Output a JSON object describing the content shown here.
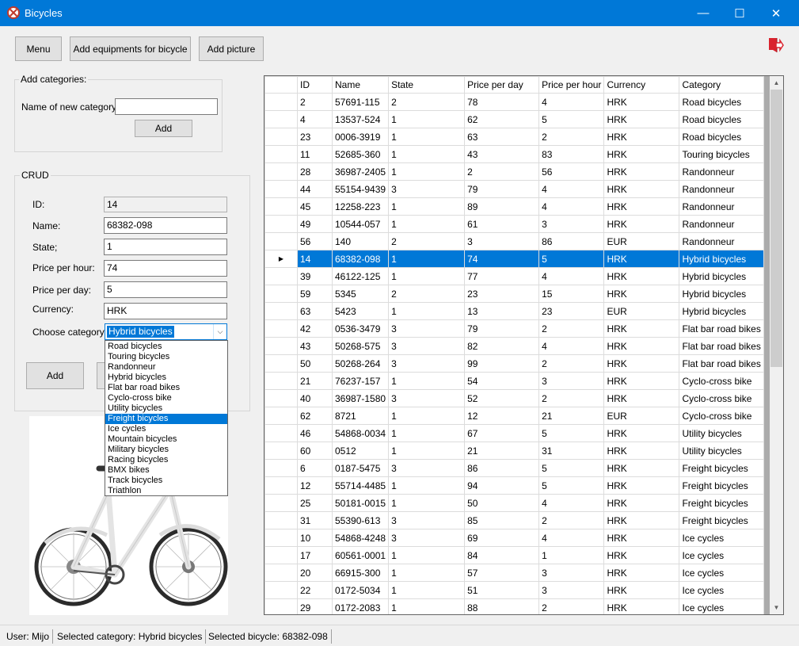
{
  "window": {
    "title": "Bicycles",
    "minimize": "—",
    "maximize": "☐",
    "close": "✕"
  },
  "toolbar": {
    "menu": "Menu",
    "add_equipment": "Add equipments for bicycle",
    "add_picture": "Add picture"
  },
  "categories_group": {
    "title": "Add categories:",
    "name_label": "Name of new category:",
    "name_value": "",
    "add": "Add"
  },
  "crud": {
    "title": "CRUD",
    "id_label": "ID:",
    "id_value": "14",
    "name_label": "Name:",
    "name_value": "68382-098",
    "state_label": "State;",
    "state_value": "1",
    "pph_label": "Price per hour:",
    "pph_value": "74",
    "ppd_label": "Price per day:",
    "ppd_value": "5",
    "currency_label": "Currency:",
    "currency_value": "HRK",
    "category_label": "Choose category:",
    "category_value": "Hybrid bicycles",
    "add": "Add"
  },
  "category_options": [
    "Road bicycles",
    "Touring bicycles",
    "Randonneur",
    "Hybrid bicycles",
    "Flat bar road bikes",
    "Cyclo-cross bike",
    "Utility bicycles",
    "Freight bicycles",
    "Ice cycles",
    "Mountain bicycles",
    "Military bicycles",
    "Racing bicycles",
    "BMX bikes",
    "Track bicycles",
    "Triathlon"
  ],
  "highlighted_option": "Freight bicycles",
  "grid": {
    "columns": [
      "ID",
      "Name",
      "State",
      "Price per day",
      "Price per hour",
      "Currency",
      "Category"
    ],
    "selected_row": 9,
    "current_row_marker": "▶",
    "rows": [
      [
        "2",
        "57691-115",
        "2",
        "78",
        "4",
        "HRK",
        "Road bicycles"
      ],
      [
        "4",
        "13537-524",
        "1",
        "62",
        "5",
        "HRK",
        "Road bicycles"
      ],
      [
        "23",
        "0006-3919",
        "1",
        "63",
        "2",
        "HRK",
        "Road bicycles"
      ],
      [
        "11",
        "52685-360",
        "1",
        "43",
        "83",
        "HRK",
        "Touring bicycles"
      ],
      [
        "28",
        "36987-2405",
        "1",
        "2",
        "56",
        "HRK",
        "Randonneur"
      ],
      [
        "44",
        "55154-9439",
        "3",
        "79",
        "4",
        "HRK",
        "Randonneur"
      ],
      [
        "45",
        "12258-223",
        "1",
        "89",
        "4",
        "HRK",
        "Randonneur"
      ],
      [
        "49",
        "10544-057",
        "1",
        "61",
        "3",
        "HRK",
        "Randonneur"
      ],
      [
        "56",
        "140",
        "2",
        "3",
        "86",
        "EUR",
        "Randonneur"
      ],
      [
        "14",
        "68382-098",
        "1",
        "74",
        "5",
        "HRK",
        "Hybrid bicycles"
      ],
      [
        "39",
        "46122-125",
        "1",
        "77",
        "4",
        "HRK",
        "Hybrid bicycles"
      ],
      [
        "59",
        "5345",
        "2",
        "23",
        "15",
        "HRK",
        "Hybrid bicycles"
      ],
      [
        "63",
        "5423",
        "1",
        "13",
        "23",
        "EUR",
        "Hybrid bicycles"
      ],
      [
        "42",
        "0536-3479",
        "3",
        "79",
        "2",
        "HRK",
        "Flat bar road bikes"
      ],
      [
        "43",
        "50268-575",
        "3",
        "82",
        "4",
        "HRK",
        "Flat bar road bikes"
      ],
      [
        "50",
        "50268-264",
        "3",
        "99",
        "2",
        "HRK",
        "Flat bar road bikes"
      ],
      [
        "21",
        "76237-157",
        "1",
        "54",
        "3",
        "HRK",
        "Cyclo-cross bike"
      ],
      [
        "40",
        "36987-1580",
        "3",
        "52",
        "2",
        "HRK",
        "Cyclo-cross bike"
      ],
      [
        "62",
        "8721",
        "1",
        "12",
        "21",
        "EUR",
        "Cyclo-cross bike"
      ],
      [
        "46",
        "54868-0034",
        "1",
        "67",
        "5",
        "HRK",
        "Utility bicycles"
      ],
      [
        "60",
        "0512",
        "1",
        "21",
        "31",
        "HRK",
        "Utility bicycles"
      ],
      [
        "6",
        "0187-5475",
        "3",
        "86",
        "5",
        "HRK",
        "Freight bicycles"
      ],
      [
        "12",
        "55714-4485",
        "1",
        "94",
        "5",
        "HRK",
        "Freight bicycles"
      ],
      [
        "25",
        "50181-0015",
        "1",
        "50",
        "4",
        "HRK",
        "Freight bicycles"
      ],
      [
        "31",
        "55390-613",
        "3",
        "85",
        "2",
        "HRK",
        "Freight bicycles"
      ],
      [
        "10",
        "54868-4248",
        "3",
        "69",
        "4",
        "HRK",
        "Ice cycles"
      ],
      [
        "17",
        "60561-0001",
        "1",
        "84",
        "1",
        "HRK",
        "Ice cycles"
      ],
      [
        "20",
        "66915-300",
        "1",
        "57",
        "3",
        "HRK",
        "Ice cycles"
      ],
      [
        "22",
        "0172-5034",
        "1",
        "51",
        "3",
        "HRK",
        "Ice cycles"
      ],
      [
        "29",
        "0172-2083",
        "1",
        "88",
        "2",
        "HRK",
        "Ice cycles"
      ]
    ]
  },
  "status": {
    "user": "User: Mijo",
    "category": "Selected category: Hybrid bicycles",
    "bicycle": "Selected bicycle: 68382-098"
  },
  "colors": {
    "accent": "#0078d7",
    "exit_icon": "#d9232e"
  }
}
